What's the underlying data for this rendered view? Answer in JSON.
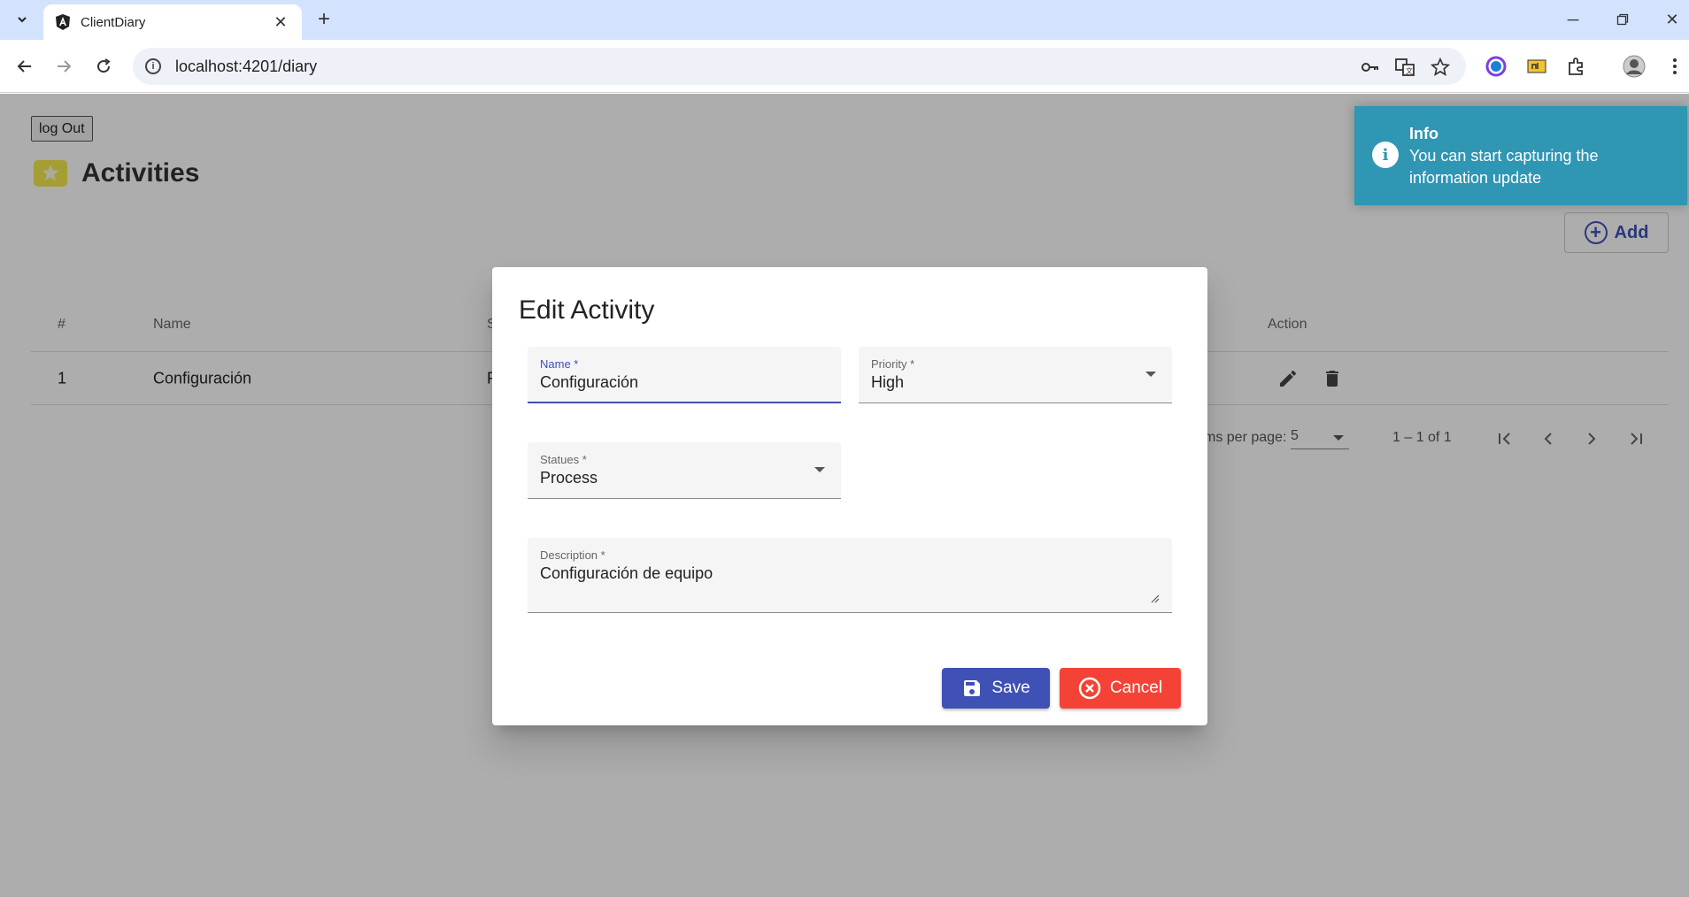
{
  "browser": {
    "tab_title": "ClientDiary",
    "url": "localhost:4201/diary",
    "new_tab_label": "+"
  },
  "page": {
    "logout_label": "log Out",
    "title": "Activities",
    "add_label": "Add",
    "table": {
      "headers": [
        "#",
        "Name",
        "S",
        "Action"
      ],
      "rows": [
        {
          "num": "1",
          "name": "Configuración",
          "status_partial": "P"
        }
      ]
    },
    "paginator": {
      "items_per_page_label": "ms per page:",
      "page_size": "5",
      "range": "1 – 1 of 1"
    }
  },
  "dialog": {
    "title": "Edit Activity",
    "name": {
      "label": "Name *",
      "value": "Configuración"
    },
    "priority": {
      "label": "Priority *",
      "value": "High"
    },
    "status": {
      "label": "Statues *",
      "value": "Process"
    },
    "description": {
      "label": "Description *",
      "value": "Configuración de equipo"
    },
    "save_label": "Save",
    "cancel_label": "Cancel"
  },
  "toast": {
    "title": "Info",
    "message": "You can start capturing the information update"
  },
  "colors": {
    "primary": "#3f51b5",
    "warn": "#f44336",
    "toast": "#2f96b4",
    "chrome_tabbar": "#d3e3fd"
  },
  "icons": [
    "tab-list-icon",
    "angular-icon",
    "close-icon",
    "back-icon",
    "forward-icon",
    "reload-icon",
    "site-info-icon",
    "key-icon",
    "translate-icon",
    "star-icon",
    "extension-icon",
    "profile-icon",
    "more-icon",
    "edit-icon",
    "delete-icon",
    "save-icon",
    "cancel-icon",
    "info-icon"
  ]
}
